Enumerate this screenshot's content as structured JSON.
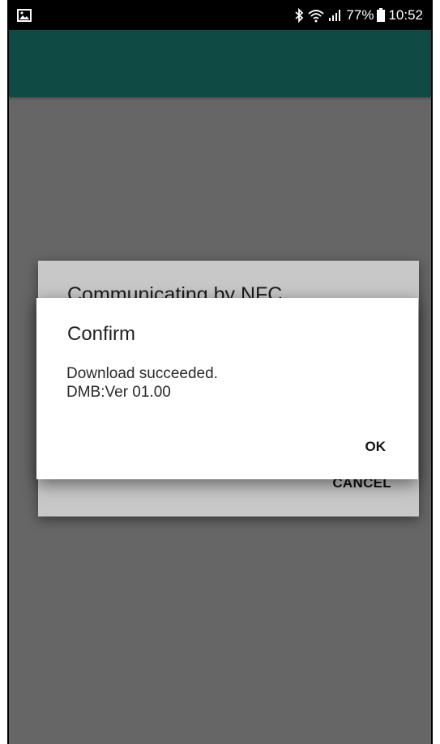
{
  "status_bar": {
    "battery_percent": "77%",
    "time": "10:52",
    "icons": [
      "image-notification-icon",
      "bluetooth-icon",
      "wifi-icon",
      "signal-icon",
      "battery-icon"
    ]
  },
  "app_bar": {
    "color": "#0f4a45"
  },
  "background_dialog": {
    "title": "Communicating by NFC",
    "cancel_label": "CANCEL"
  },
  "confirm_dialog": {
    "title": "Confirm",
    "message_lines": [
      "Download succeeded.",
      "DMB:Ver 01.00"
    ],
    "ok_label": "OK"
  }
}
